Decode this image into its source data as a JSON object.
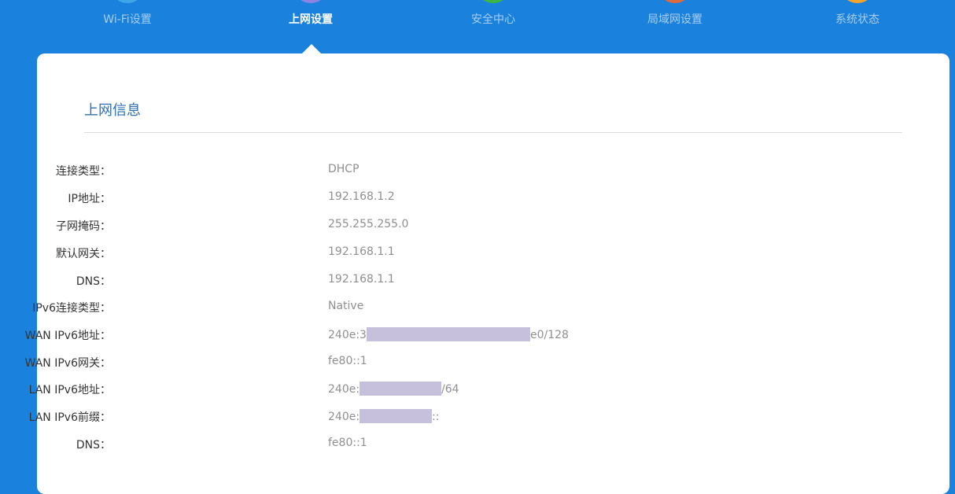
{
  "nav": {
    "items": [
      {
        "label": "Wi-Fi设置",
        "color": "#3ea6e6"
      },
      {
        "label": "上网设置",
        "color": "#8e83e0",
        "active": true
      },
      {
        "label": "安全中心",
        "color": "#3fb643"
      },
      {
        "label": "局域网设置",
        "color": "#e06a3b"
      },
      {
        "label": "系统状态",
        "color": "#f4a62a"
      }
    ]
  },
  "panel": {
    "title": "上网信息",
    "rows": [
      {
        "label": "连接类型：",
        "value": "DHCP"
      },
      {
        "label": "IP地址：",
        "value": "192.168.1.2"
      },
      {
        "label": "子网掩码：",
        "value": "255.255.255.0"
      },
      {
        "label": "默认网关：",
        "value": "192.168.1.1"
      },
      {
        "label": "DNS：",
        "value": "192.168.1.1"
      },
      {
        "label": "IPv6连接类型：",
        "value": "Native"
      },
      {
        "label": "WAN IPv6地址：",
        "value_prefix": "240e:3",
        "value_suffix": "e0/128"
      },
      {
        "label": "WAN IPv6网关：",
        "value": "fe80::1"
      },
      {
        "label": "LAN IPv6地址：",
        "value_prefix": "240e:",
        "value_suffix": "/64"
      },
      {
        "label": "LAN IPv6前缀：",
        "value_prefix": "240e:",
        "value_suffix": "::"
      },
      {
        "label": "DNS：",
        "value": "fe80::1"
      }
    ]
  }
}
